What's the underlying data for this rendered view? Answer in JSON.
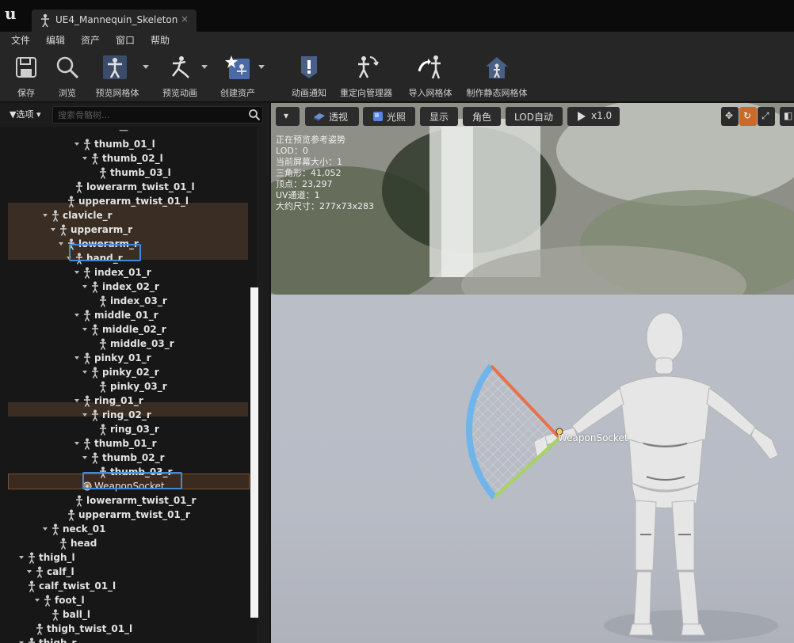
{
  "window": {
    "tab_title": "UE4_Mannequin_Skeleton",
    "close_glyph": "×"
  },
  "menu": [
    "文件",
    "编辑",
    "资产",
    "窗口",
    "帮助"
  ],
  "toolbar": {
    "items": [
      {
        "label": "保存",
        "icon": "save-icon"
      },
      {
        "label": "浏览",
        "icon": "browse-icon"
      },
      {
        "label": "预览网格体",
        "icon": "preview-mesh-icon",
        "dropdown": true
      },
      {
        "label": "预览动画",
        "icon": "preview-animation-icon",
        "dropdown": true
      },
      {
        "label": "创建资产",
        "icon": "create-asset-icon",
        "dropdown": true
      },
      {
        "label": "动画通知",
        "icon": "anim-notify-icon"
      },
      {
        "label": "重定向管理器",
        "icon": "retarget-manager-icon"
      },
      {
        "label": "导入网格体",
        "icon": "import-mesh-icon"
      },
      {
        "label": "制作静态网格体",
        "icon": "make-static-mesh-icon"
      }
    ]
  },
  "skeleton_tree": {
    "options_label": "选项",
    "search_placeholder": "搜索骨骼树...",
    "rows": [
      {
        "label": "thumb_01_l",
        "expanded": true
      },
      {
        "label": "thumb_02_l",
        "expanded": true
      },
      {
        "label": "thumb_03_l",
        "expanded": false
      },
      {
        "label": "lowerarm_twist_01_l",
        "expanded": false
      },
      {
        "label": "upperarm_twist_01_l",
        "expanded": false
      },
      {
        "label": "clavicle_r",
        "expanded": true
      },
      {
        "label": "upperarm_r",
        "expanded": true
      },
      {
        "label": "lowerarm_r",
        "expanded": true
      },
      {
        "label": "hand_r",
        "expanded": true
      },
      {
        "label": "index_01_r",
        "expanded": true
      },
      {
        "label": "index_02_r",
        "expanded": true
      },
      {
        "label": "index_03_r",
        "expanded": false
      },
      {
        "label": "middle_01_r",
        "expanded": true
      },
      {
        "label": "middle_02_r",
        "expanded": true
      },
      {
        "label": "middle_03_r",
        "expanded": false
      },
      {
        "label": "pinky_01_r",
        "expanded": true
      },
      {
        "label": "pinky_02_r",
        "expanded": true
      },
      {
        "label": "pinky_03_r",
        "expanded": false
      },
      {
        "label": "ring_01_r",
        "expanded": true
      },
      {
        "label": "ring_02_r",
        "expanded": true
      },
      {
        "label": "ring_03_r",
        "expanded": false
      },
      {
        "label": "thumb_01_r",
        "expanded": true
      },
      {
        "label": "thumb_02_r",
        "expanded": true
      },
      {
        "label": "thumb_03_r",
        "expanded": false
      },
      {
        "label": "WeaponSocket",
        "expanded": false,
        "socket": true
      },
      {
        "label": "lowerarm_twist_01_r",
        "expanded": false
      },
      {
        "label": "upperarm_twist_01_r",
        "expanded": false
      },
      {
        "label": "neck_01",
        "expanded": true
      },
      {
        "label": "head",
        "expanded": false
      },
      {
        "label": "thigh_l",
        "expanded": true
      },
      {
        "label": "calf_l",
        "expanded": true
      },
      {
        "label": "calf_twist_01_l",
        "expanded": false
      },
      {
        "label": "foot_l",
        "expanded": true
      },
      {
        "label": "ball_l",
        "expanded": false
      },
      {
        "label": "thigh_twist_01_l",
        "expanded": false
      },
      {
        "label": "thigh_r",
        "expanded": true
      }
    ]
  },
  "viewport": {
    "buttons": [
      "透视",
      "光照",
      "显示",
      "角色",
      "LOD自动",
      "x1.0"
    ],
    "stats": [
      "正在预览参考姿势",
      "LOD：0",
      "当前屏幕大小：1",
      "三角形：41,052",
      "顶点：23,297",
      "UV通道：1",
      "大约尺寸：277x73x283"
    ],
    "socket_label": "WeaponSocket"
  },
  "colors": {
    "selection": "#3d8bd9",
    "highlight_band": "#3a2e24",
    "active_tool": "#c86a2a"
  }
}
